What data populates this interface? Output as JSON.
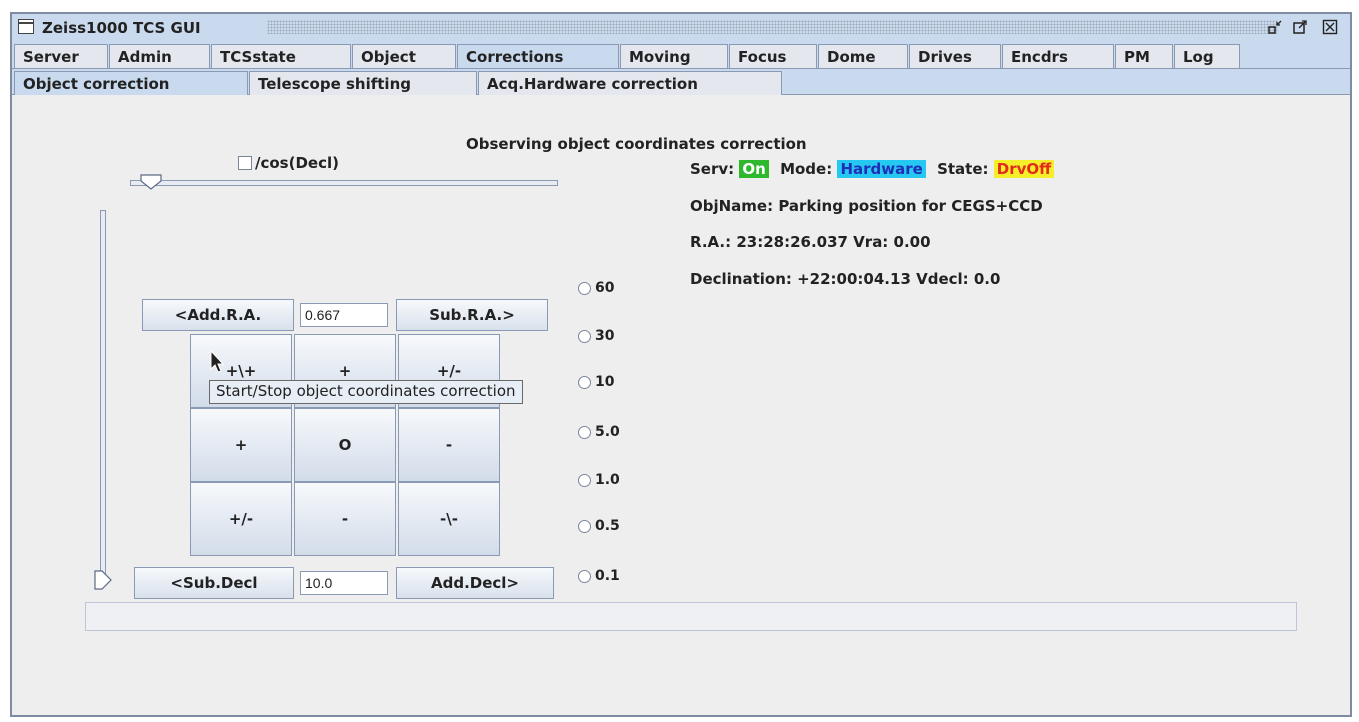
{
  "window": {
    "title": "Zeiss1000 TCS GUI",
    "controls": [
      "minimize-icon",
      "maximize-icon",
      "close-icon"
    ]
  },
  "main_tabs": [
    {
      "label": "Server"
    },
    {
      "label": "Admin"
    },
    {
      "label": "TCSstate"
    },
    {
      "label": "Object"
    },
    {
      "label": "Corrections",
      "active": true
    },
    {
      "label": "Moving"
    },
    {
      "label": "Focus"
    },
    {
      "label": "Dome"
    },
    {
      "label": "Drives"
    },
    {
      "label": "Encdrs"
    },
    {
      "label": "PM"
    },
    {
      "label": "Log"
    }
  ],
  "sub_tabs": [
    {
      "label": "Object correction",
      "active": true
    },
    {
      "label": "Telescope shifting"
    },
    {
      "label": "Acq.Hardware correction"
    }
  ],
  "panel": {
    "heading": "Observing object coordinates correction",
    "cos_decl_label": "/cos(Decl)",
    "cos_decl_checked": false,
    "add_ra_label": "<Add.R.A.",
    "ra_step_value": "0.667",
    "sub_ra_label": "Sub.R.A.>",
    "sub_decl_label": "<Sub.Decl",
    "decl_step_value": "10.0",
    "add_decl_label": "Add.Decl>",
    "grid": [
      "+\\+",
      "+",
      "+/-",
      "+",
      "O",
      "-",
      "+/-",
      "-",
      "-\\-"
    ],
    "tooltip": "Start/Stop object coordinates correction",
    "rates": [
      "60",
      "30",
      "10",
      "5.0",
      "1.0",
      "0.5",
      "0.1"
    ],
    "horizontal_slider_level": 0.05,
    "vertical_slider_level": 0.0
  },
  "status": {
    "serv_label": "Serv:",
    "serv_value": "On",
    "mode_label": "Mode:",
    "mode_value": "Hardware",
    "state_label": "State:",
    "state_value": "DrvOff",
    "objname": "ObjName: Parking position for CEGS+CCD",
    "ra_line": "R.A.: 23:28:26.037  Vra: 0.00",
    "dec_line": "Declination: +22:00:04.13  Vdecl: 0.0"
  },
  "colors": {
    "serv_on": "#2db82d",
    "mode_hardware": "#25c8f0",
    "state_drvoff_bg": "#f5ef2a",
    "state_drvoff_text": "#e22b1b"
  }
}
